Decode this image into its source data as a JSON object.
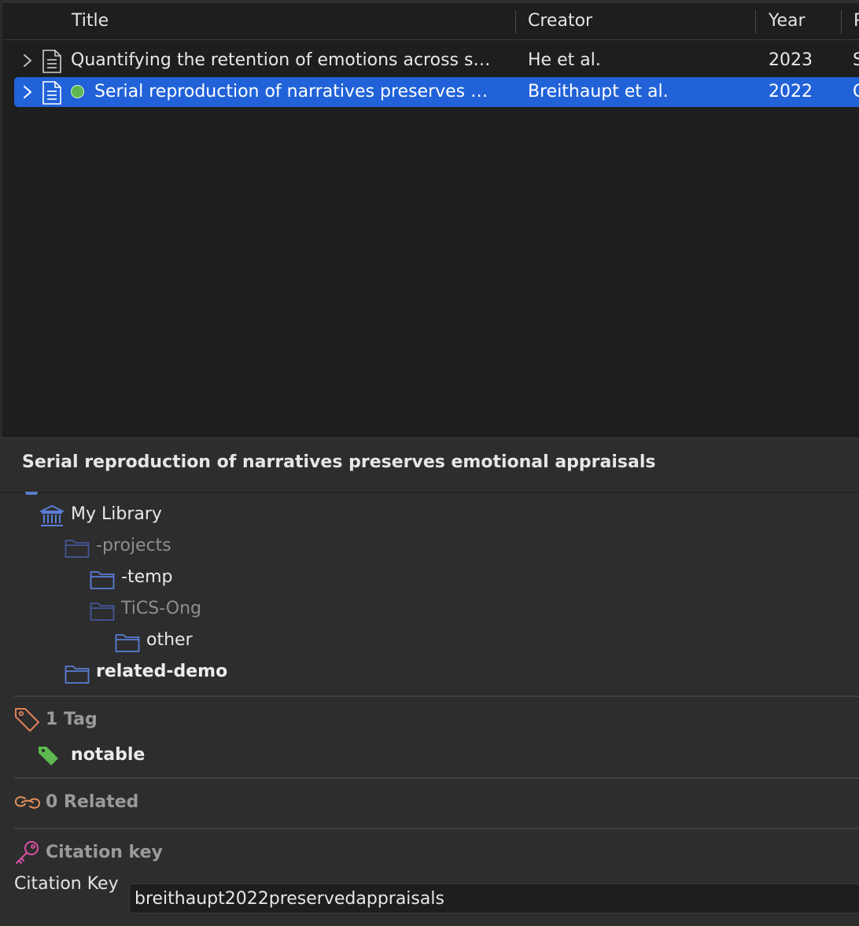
{
  "columns": {
    "title": "Title",
    "creator": "Creator",
    "year": "Year",
    "next_partial": "P"
  },
  "items": [
    {
      "title": "Quantifying the retention of emotions across s…",
      "creator": "He et al.",
      "year": "2023",
      "extra": "S",
      "selected": false
    },
    {
      "title": "Serial reproduction of narratives preserves …",
      "creator": "Breithaupt et al.",
      "year": "2022",
      "extra": "C",
      "selected": true,
      "status_color": "#5cb84f"
    }
  ],
  "item_pane": {
    "title": "Serial reproduction of narratives preserves emotional appraisals",
    "libraries": {
      "library_name": "My Library",
      "collections": [
        {
          "label": "-projects",
          "level": 1,
          "dim": true,
          "bold": false
        },
        {
          "label": "-temp",
          "level": 2,
          "dim": false,
          "bold": false
        },
        {
          "label": "TiCS-Ong",
          "level": 2,
          "dim": true,
          "bold": false
        },
        {
          "label": "other",
          "level": 3,
          "dim": false,
          "bold": false
        },
        {
          "label": "related-demo",
          "level": 1,
          "dim": false,
          "bold": true
        }
      ]
    },
    "tags": {
      "header": "1 Tag",
      "items": [
        "notable"
      ],
      "tag_color": "#5cb84f"
    },
    "related": {
      "header": "0 Related"
    },
    "citation": {
      "header": "Citation key",
      "field_label": "Citation Key",
      "value": "breithaupt2022preservedappraisals"
    }
  },
  "colors": {
    "selection": "#2162d8",
    "folder_blue": "#5a7ed8",
    "tag_icon": "#e0805a",
    "related_icon": "#e0905a",
    "key_icon": "#d94fa8"
  }
}
